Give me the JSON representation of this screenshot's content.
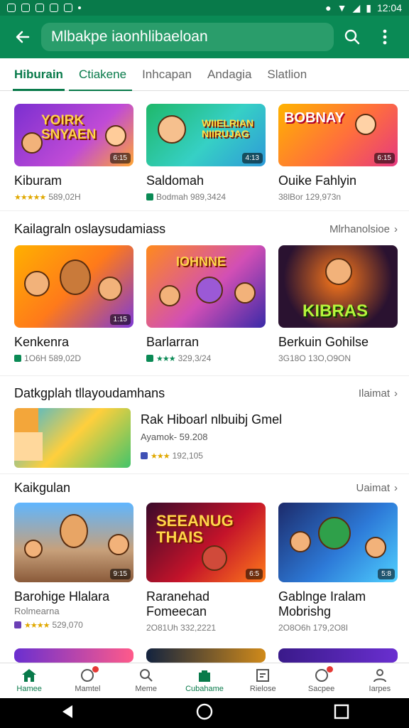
{
  "status": {
    "time": "12:04"
  },
  "appbar": {
    "search_text": "Mlbakpe iaonhlibaeloan"
  },
  "tabs": [
    "Hiburain",
    "Ctiakene",
    "Inhcapan",
    "Andagia",
    "Slatlion"
  ],
  "row1": [
    {
      "title": "Kiburam",
      "meta": "589,02H",
      "badge": "6:15",
      "art": "YOIRK SNYAEN"
    },
    {
      "title": "Saldomah",
      "meta": "Bodmah 989,3424",
      "badge": "4:13",
      "art": "WIIELRIAN NIIRUJAG"
    },
    {
      "title": "Ouike Fahlyin",
      "meta": "38lBor 129,973n",
      "badge": "6:15",
      "art": "BOBNAY"
    }
  ],
  "section2": {
    "title": "Kailagraln oslaysudamiass",
    "link": "Mlrhanolsioe"
  },
  "row2": [
    {
      "title": "Kenkenra",
      "meta": "1O6H 589,02D",
      "badge": "1:15",
      "art": ""
    },
    {
      "title": "Barlarran",
      "meta": "329,3/24",
      "badge": "",
      "art": "IOHNNE"
    },
    {
      "title": "Berkuin Gohilse",
      "meta": "3G18O 13O,O9ON",
      "badge": "",
      "art": "KIBRAS"
    }
  ],
  "section3": {
    "title": "Datkgplah tllayoudamhans",
    "link": "Ilaimat"
  },
  "featured": {
    "title": "Rak Hiboarl nlbuibj Gmel",
    "subtitle": "Ayamok- 59.208",
    "meta": "192,105"
  },
  "section4": {
    "title": "Kaikgulan",
    "link": "Uaimat"
  },
  "row3": [
    {
      "title": "Barohige Hlalara",
      "title2": "Rolmearna",
      "meta": "529,070",
      "badge": "9:15"
    },
    {
      "title": "Raranehad",
      "title2": "Fomeecan",
      "meta": "2O81Uh 332,2221",
      "badge": "6:5",
      "art": "SEEANUG THAIS"
    },
    {
      "title": "Gablnge Iralam",
      "title2": "Mobrishg",
      "meta": "2O8O6h 179,2O8I",
      "badge": "5:8"
    }
  ],
  "bottom_nav": [
    {
      "label": "Hamee",
      "icon": "home-icon"
    },
    {
      "label": "Mamtel",
      "icon": "gamepad-icon"
    },
    {
      "label": "Meme",
      "icon": "search-icon"
    },
    {
      "label": "Cubahame",
      "icon": "store-icon"
    },
    {
      "label": "Rielose",
      "icon": "library-icon"
    },
    {
      "label": "Sacpee",
      "icon": "heart-icon"
    },
    {
      "label": "Iarpes",
      "icon": "profile-icon"
    }
  ]
}
